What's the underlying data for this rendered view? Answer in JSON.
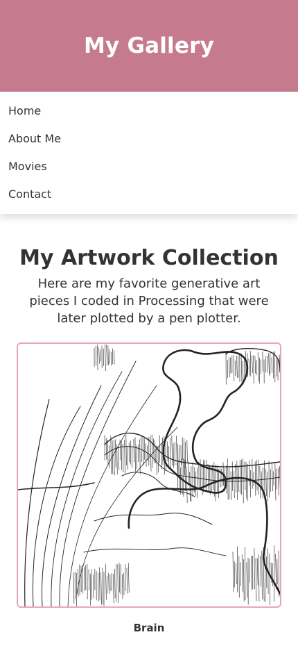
{
  "header": {
    "title": "My Gallery"
  },
  "nav": {
    "items": [
      {
        "label": "Home"
      },
      {
        "label": "About Me"
      },
      {
        "label": "Movies"
      },
      {
        "label": "Contact"
      }
    ]
  },
  "main": {
    "heading": "My Artwork Collection",
    "intro": "Here are my favorite generative art pieces I coded in Processing that were later plotted by a pen plotter."
  },
  "artwork": {
    "title": "Brain"
  },
  "colors": {
    "header_bg": "#c57b8d",
    "card_border": "#e7a6b9",
    "text": "#333333"
  }
}
